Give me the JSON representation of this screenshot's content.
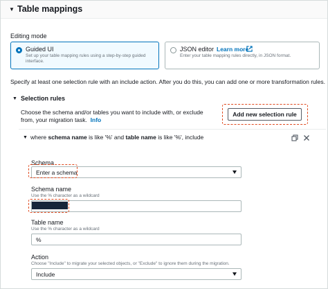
{
  "panel": {
    "title": "Table mappings"
  },
  "editing_mode": {
    "label": "Editing mode",
    "guided": {
      "title": "Guided UI",
      "description": "Set up your table mapping rules using a step-by-step guided interface.",
      "selected": true
    },
    "json": {
      "title": "JSON editor",
      "learn_more": "Learn more",
      "description": "Enter your table mapping rules directly, in JSON format.",
      "selected": false
    }
  },
  "instruction": "Specify at least one selection rule with an include action. After you do this, you can add one or more transformation rules.",
  "selection_rules": {
    "title": "Selection rules",
    "description": "Choose the schema and/or tables you want to include with, or exclude from, your migration task.",
    "info_link": "Info",
    "add_button": "Add new selection rule",
    "rule": {
      "prefix": "where ",
      "schema_name_bold": "schema name",
      "middle": " is like '%' and ",
      "table_name_bold": "table name",
      "suffix": " is like '%', include"
    },
    "fields": {
      "schema": {
        "label": "Schema",
        "value": "Enter a schema"
      },
      "schema_name": {
        "label": "Schema name",
        "hint": "Use the % character as a wildcard",
        "value": ""
      },
      "table_name": {
        "label": "Table name",
        "hint": "Use the % character as a wildcard",
        "value": "%"
      },
      "action": {
        "label": "Action",
        "hint": "Choose \"Include\" to migrate your selected objects, or \"Exclude\" to ignore them during the migration.",
        "value": "Include"
      }
    }
  },
  "icons": {
    "panel_caret": "caret-down-icon",
    "external_link": "external-link-icon",
    "copy": "copy-icon",
    "close": "close-icon"
  },
  "colors": {
    "link": "#0073bb",
    "highlight": "#e0491e",
    "redaction": "#16253a"
  }
}
